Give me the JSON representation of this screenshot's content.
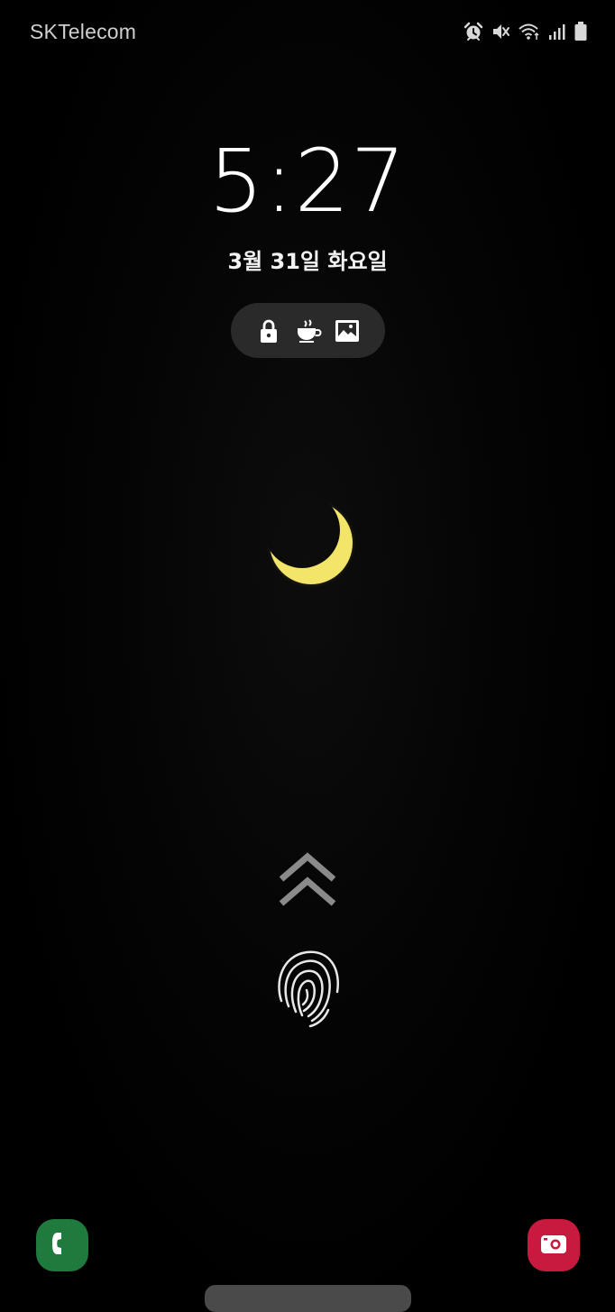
{
  "status_bar": {
    "carrier": "SKTelecom",
    "icons": [
      "alarm-icon",
      "mute-icon",
      "wifi-icon",
      "signal-icon",
      "battery-icon"
    ]
  },
  "lock_screen": {
    "time": "5:27",
    "date": "3월 31일 화요일",
    "pill_icons": [
      "lock-icon",
      "coffee-cup-icon",
      "image-icon"
    ]
  },
  "wallpaper": {
    "subject": "crescent-moon",
    "moon_color": "#f3e56a"
  },
  "unlock": {
    "icons": [
      "swipe-up-chevrons-icon",
      "fingerprint-icon"
    ]
  },
  "shortcuts": {
    "left": {
      "icon": "phone-icon",
      "color": "#1f7a3e"
    },
    "right": {
      "icon": "camera-icon",
      "color": "#c8193f"
    }
  }
}
